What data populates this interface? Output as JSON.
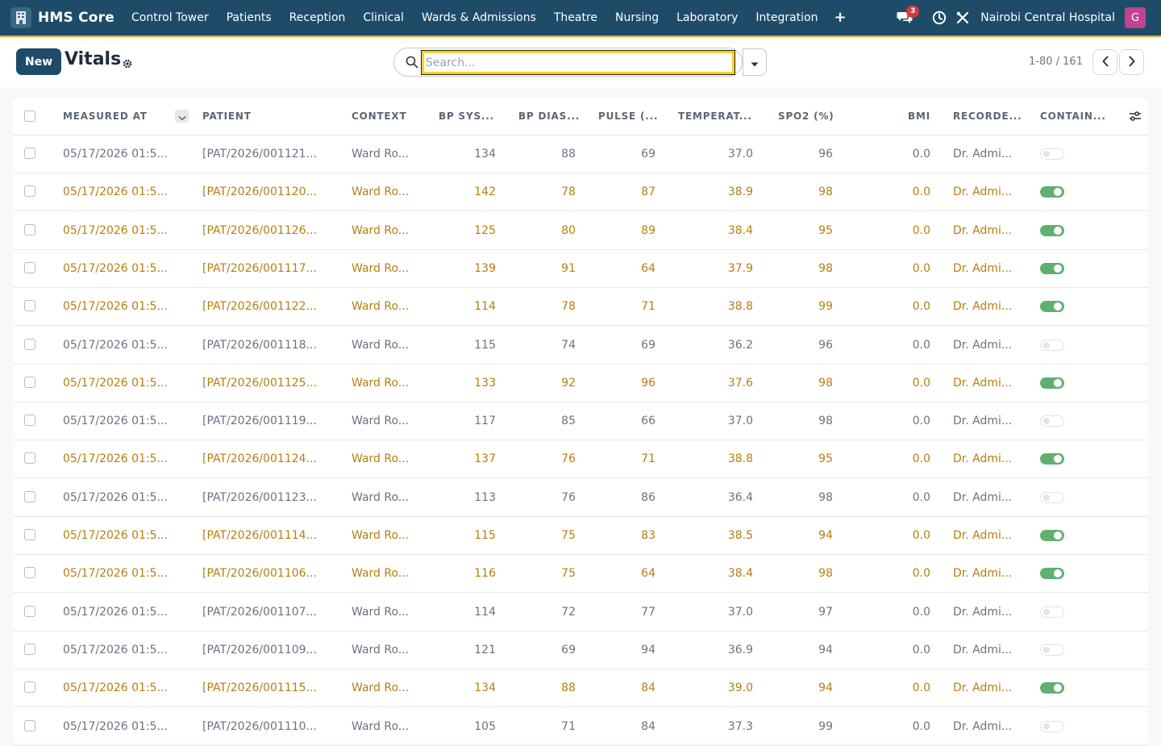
{
  "navbar": {
    "brand": "HMS Core",
    "items": [
      "Control Tower",
      "Patients",
      "Reception",
      "Clinical",
      "Wards & Admissions",
      "Theatre",
      "Nursing",
      "Laboratory",
      "Integration"
    ],
    "plus_icon": "plus-icon",
    "notifications_count": "3",
    "hospital": "Nairobi Central Hospital",
    "avatar_initial": "G",
    "colors": {
      "bg": "#1e4c68",
      "accent": "#e8a33a",
      "avatar": "#c2438f"
    }
  },
  "page": {
    "new_label": "New",
    "title": "Vitals",
    "search_placeholder": "Search...",
    "pager": "1-80 / 161"
  },
  "table": {
    "columns": [
      "MEASURED AT",
      "PATIENT",
      "CONTEXT",
      "BP SYS...",
      "BP DIAS...",
      "PULSE (...",
      "TEMPERAT...",
      "SPO2 (%)",
      "BMI",
      "RECORDE...",
      "CONTAIN..."
    ],
    "rows": [
      {
        "measured_at": "05/17/2026 01:5...",
        "patient": "[PAT/2026/001121...",
        "context": "Ward Ro...",
        "bp_sys": "134",
        "bp_dias": "88",
        "pulse": "69",
        "temp": "37.0",
        "spo2": "96",
        "bmi": "0.0",
        "recorder": "Dr. Admi...",
        "flag": false
      },
      {
        "measured_at": "05/17/2026 01:5...",
        "patient": "[PAT/2026/001120...",
        "context": "Ward Ro...",
        "bp_sys": "142",
        "bp_dias": "78",
        "pulse": "87",
        "temp": "38.9",
        "spo2": "98",
        "bmi": "0.0",
        "recorder": "Dr. Admi...",
        "flag": true
      },
      {
        "measured_at": "05/17/2026 01:5...",
        "patient": "[PAT/2026/001126...",
        "context": "Ward Ro...",
        "bp_sys": "125",
        "bp_dias": "80",
        "pulse": "89",
        "temp": "38.4",
        "spo2": "95",
        "bmi": "0.0",
        "recorder": "Dr. Admi...",
        "flag": true
      },
      {
        "measured_at": "05/17/2026 01:5...",
        "patient": "[PAT/2026/001117...",
        "context": "Ward Ro...",
        "bp_sys": "139",
        "bp_dias": "91",
        "pulse": "64",
        "temp": "37.9",
        "spo2": "98",
        "bmi": "0.0",
        "recorder": "Dr. Admi...",
        "flag": true
      },
      {
        "measured_at": "05/17/2026 01:5...",
        "patient": "[PAT/2026/001122...",
        "context": "Ward Ro...",
        "bp_sys": "114",
        "bp_dias": "78",
        "pulse": "71",
        "temp": "38.8",
        "spo2": "99",
        "bmi": "0.0",
        "recorder": "Dr. Admi...",
        "flag": true
      },
      {
        "measured_at": "05/17/2026 01:5...",
        "patient": "[PAT/2026/001118...",
        "context": "Ward Ro...",
        "bp_sys": "115",
        "bp_dias": "74",
        "pulse": "69",
        "temp": "36.2",
        "spo2": "96",
        "bmi": "0.0",
        "recorder": "Dr. Admi...",
        "flag": false
      },
      {
        "measured_at": "05/17/2026 01:5...",
        "patient": "[PAT/2026/001125...",
        "context": "Ward Ro...",
        "bp_sys": "133",
        "bp_dias": "92",
        "pulse": "96",
        "temp": "37.6",
        "spo2": "98",
        "bmi": "0.0",
        "recorder": "Dr. Admi...",
        "flag": true
      },
      {
        "measured_at": "05/17/2026 01:5...",
        "patient": "[PAT/2026/001119...",
        "context": "Ward Ro...",
        "bp_sys": "117",
        "bp_dias": "85",
        "pulse": "66",
        "temp": "37.0",
        "spo2": "98",
        "bmi": "0.0",
        "recorder": "Dr. Admi...",
        "flag": false
      },
      {
        "measured_at": "05/17/2026 01:5...",
        "patient": "[PAT/2026/001124...",
        "context": "Ward Ro...",
        "bp_sys": "137",
        "bp_dias": "76",
        "pulse": "71",
        "temp": "38.8",
        "spo2": "95",
        "bmi": "0.0",
        "recorder": "Dr. Admi...",
        "flag": true
      },
      {
        "measured_at": "05/17/2026 01:5...",
        "patient": "[PAT/2026/001123...",
        "context": "Ward Ro...",
        "bp_sys": "113",
        "bp_dias": "76",
        "pulse": "86",
        "temp": "36.4",
        "spo2": "98",
        "bmi": "0.0",
        "recorder": "Dr. Admi...",
        "flag": false
      },
      {
        "measured_at": "05/17/2026 01:5...",
        "patient": "[PAT/2026/001114...",
        "context": "Ward Ro...",
        "bp_sys": "115",
        "bp_dias": "75",
        "pulse": "83",
        "temp": "38.5",
        "spo2": "94",
        "bmi": "0.0",
        "recorder": "Dr. Admi...",
        "flag": true
      },
      {
        "measured_at": "05/17/2026 01:5...",
        "patient": "[PAT/2026/001106...",
        "context": "Ward Ro...",
        "bp_sys": "116",
        "bp_dias": "75",
        "pulse": "64",
        "temp": "38.4",
        "spo2": "98",
        "bmi": "0.0",
        "recorder": "Dr. Admi...",
        "flag": true
      },
      {
        "measured_at": "05/17/2026 01:5...",
        "patient": "[PAT/2026/001107...",
        "context": "Ward Ro...",
        "bp_sys": "114",
        "bp_dias": "72",
        "pulse": "77",
        "temp": "37.0",
        "spo2": "97",
        "bmi": "0.0",
        "recorder": "Dr. Admi...",
        "flag": false
      },
      {
        "measured_at": "05/17/2026 01:5...",
        "patient": "[PAT/2026/001109...",
        "context": "Ward Ro...",
        "bp_sys": "121",
        "bp_dias": "69",
        "pulse": "94",
        "temp": "36.9",
        "spo2": "94",
        "bmi": "0.0",
        "recorder": "Dr. Admi...",
        "flag": false
      },
      {
        "measured_at": "05/17/2026 01:5...",
        "patient": "[PAT/2026/001115...",
        "context": "Ward Ro...",
        "bp_sys": "134",
        "bp_dias": "88",
        "pulse": "84",
        "temp": "39.0",
        "spo2": "94",
        "bmi": "0.0",
        "recorder": "Dr. Admi...",
        "flag": true
      },
      {
        "measured_at": "05/17/2026 01:5...",
        "patient": "[PAT/2026/001110...",
        "context": "Ward Ro...",
        "bp_sys": "105",
        "bp_dias": "71",
        "pulse": "84",
        "temp": "37.3",
        "spo2": "99",
        "bmi": "0.0",
        "recorder": "Dr. Admi...",
        "flag": false
      }
    ],
    "colors": {
      "flag_text": "#b57f10",
      "normal_text": "#6b7280",
      "toggle_on": "#5fb06f"
    }
  }
}
